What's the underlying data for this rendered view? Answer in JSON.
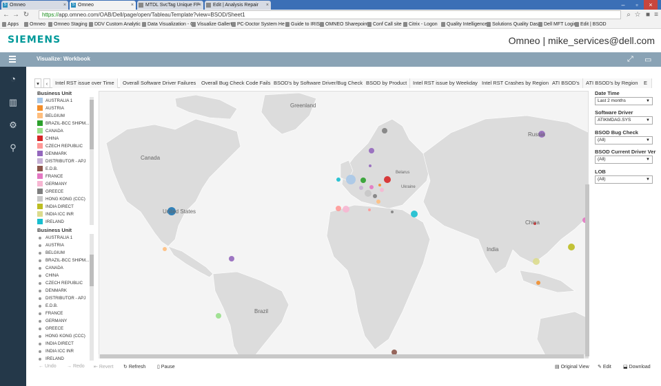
{
  "browser": {
    "tabs": [
      {
        "label": "Omneo",
        "active": false
      },
      {
        "label": "Omneo",
        "active": true
      },
      {
        "label": "MTDL SvcTag Unique FP",
        "active": false
      },
      {
        "label": "Edit | Analysis Repair",
        "active": false
      }
    ],
    "url_scheme": "https://",
    "url_rest": "app.omneo.com/OAB/Dell/page/open/TableauTemplate?view=BSOD/Sheet1",
    "bookmarks": [
      "Apps",
      "Omneo",
      "Omneo Staging",
      "DDV Custom Analytic",
      "Data Visualization - C",
      "Visualize Gallert",
      "PC-Doctor System He",
      "Guide to IRIS",
      "OMNEO Sharepoint",
      "Conf Call site",
      "Citrix - Logon",
      "Quality Intelligence",
      "Solutions Quality Das",
      "Dell MFT Login",
      "Edit | BSOD"
    ]
  },
  "header": {
    "logo": "SIEMENS",
    "user": "Omneo | mike_services@dell.com"
  },
  "appbar": {
    "title": "Visualize: Workbook"
  },
  "sheet_tabs": [
    "Intel RST issue over Time",
    "Overall Software Driver Failures",
    "Overall Bug Check Code Fails",
    "BSOD's by Software Driver/Bug Check",
    "BSOD by Product",
    "Intel RST issue by Weekday",
    "Intel RST Crashes by Region",
    "ATI BSOD's",
    "ATI BSOD's by Region",
    "E"
  ],
  "legend_panel": {
    "title": "Business Unit",
    "items": [
      {
        "label": "AUSTRALIA 1",
        "color": "#a8c8e8"
      },
      {
        "label": "AUSTRIA",
        "color": "#f28e2b"
      },
      {
        "label": "BELGIUM",
        "color": "#ffbe7d"
      },
      {
        "label": "BRAZIL-BCC SHIPM...",
        "color": "#2ca02c"
      },
      {
        "label": "CANADA",
        "color": "#98df8a"
      },
      {
        "label": "CHINA",
        "color": "#d62728"
      },
      {
        "label": "CZECH REPUBLIC",
        "color": "#ff9896"
      },
      {
        "label": "DENMARK",
        "color": "#9467bd"
      },
      {
        "label": "DISTRIBUTOR - APJ",
        "color": "#c5b0d5"
      },
      {
        "label": "E.D.B.",
        "color": "#8c564b"
      },
      {
        "label": "FRANCE",
        "color": "#e377c2"
      },
      {
        "label": "GERMANY",
        "color": "#f7b6d2"
      },
      {
        "label": "GREECE",
        "color": "#7f7f7f"
      },
      {
        "label": "HONG KONG (CCC)",
        "color": "#c7c7c7"
      },
      {
        "label": "INDIA DIRECT",
        "color": "#bcbd22"
      },
      {
        "label": "INDIA ICC INR",
        "color": "#dbdb8d"
      },
      {
        "label": "IRELAND",
        "color": "#17becf"
      }
    ]
  },
  "filter_panel": {
    "title": "Business Unit",
    "items": [
      "AUSTRALIA 1",
      "AUSTRIA",
      "BELGIUM",
      "BRAZIL-BCC SHIPM...",
      "CANADA",
      "CHINA",
      "CZECH REPUBLIC",
      "DENMARK",
      "DISTRIBUTOR - APJ",
      "E.D.B.",
      "FRANCE",
      "GERMANY",
      "GREECE",
      "HONG KONG (CCC)",
      "INDIA DIRECT",
      "INDIA ICC INR",
      "IRELAND"
    ]
  },
  "map": {
    "labels": {
      "greenland": "Greenland",
      "canada": "Canada",
      "united_states": "United States",
      "russia": "Russia",
      "belarus": "Belarus",
      "ukraine": "Ukraine",
      "china": "China",
      "india": "India",
      "brazil": "Brazil"
    }
  },
  "right_filters": [
    {
      "title": "Date Time",
      "value": "Last 2 months"
    },
    {
      "title": "Software Driver",
      "value": "ATIKMDAG.SYS"
    },
    {
      "title": "BSOD Bug Check",
      "value": "(All)"
    },
    {
      "title": "BSOD Current Driver Ver",
      "value": "(All)"
    },
    {
      "title": "LOB",
      "value": "(All)"
    }
  ],
  "toolbar": {
    "undo": "Undo",
    "redo": "Redo",
    "revert": "Revert",
    "refresh": "Refresh",
    "pause": "Pause",
    "original_view": "Original View",
    "edit": "Edit",
    "download": "Download"
  }
}
